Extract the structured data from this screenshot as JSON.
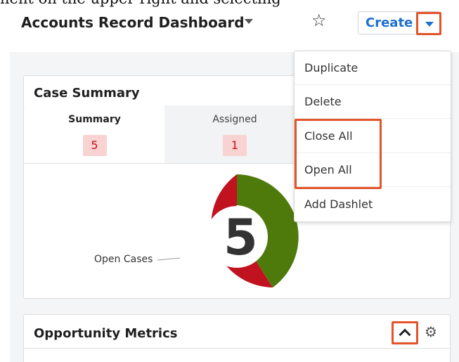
{
  "caption": "hent on the upper-right and selecting \"",
  "header": {
    "title": "Accounts Record Dashboard",
    "title_menu_icon": "caret-down-icon",
    "favorite_icon": "star-outline-icon",
    "create_label": "Create",
    "dropdown_icon": "caret-down-icon"
  },
  "actions_menu": {
    "items": [
      {
        "label": "Duplicate"
      },
      {
        "label": "Delete"
      },
      {
        "label": "Close All"
      },
      {
        "label": "Open All"
      },
      {
        "label": "Add Dashlet"
      }
    ]
  },
  "case_summary": {
    "title": "Case Summary",
    "tabs": [
      {
        "label": "Summary",
        "count": "5"
      },
      {
        "label": "Assigned",
        "count": "1"
      }
    ],
    "chart_total": "5",
    "legend_label": "Open Cases"
  },
  "opportunity_metrics": {
    "title": "Opportunity Metrics",
    "collapse_icon": "chevron-up-icon",
    "settings_icon": "gear-icon"
  },
  "colors": {
    "highlight": "#e2542a",
    "donut_red": "#c0121f",
    "donut_green": "#4e7a0b",
    "link_blue": "#1d6fcf"
  }
}
